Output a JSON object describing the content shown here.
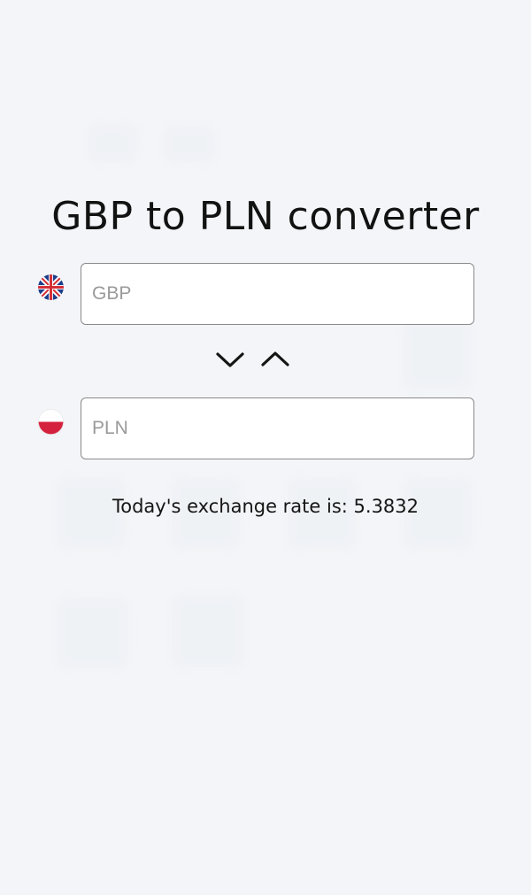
{
  "header": {
    "title": "GBP to PLN converter"
  },
  "converter": {
    "from": {
      "currency": "GBP",
      "placeholder": "GBP",
      "value": "",
      "flag": "uk-flag-icon"
    },
    "to": {
      "currency": "PLN",
      "placeholder": "PLN",
      "value": "",
      "flag": "poland-flag-icon"
    },
    "swap_icons": [
      "chevron-down-icon",
      "chevron-up-icon"
    ]
  },
  "rate": {
    "label": "Today's exchange rate is:",
    "value": "5.3832",
    "text": "Today's exchange rate is: 5.3832"
  },
  "colors": {
    "background": "#f3f5f8",
    "input_border": "#8a8a8a",
    "text": "#121212",
    "placeholder": "#9a9a9a"
  }
}
